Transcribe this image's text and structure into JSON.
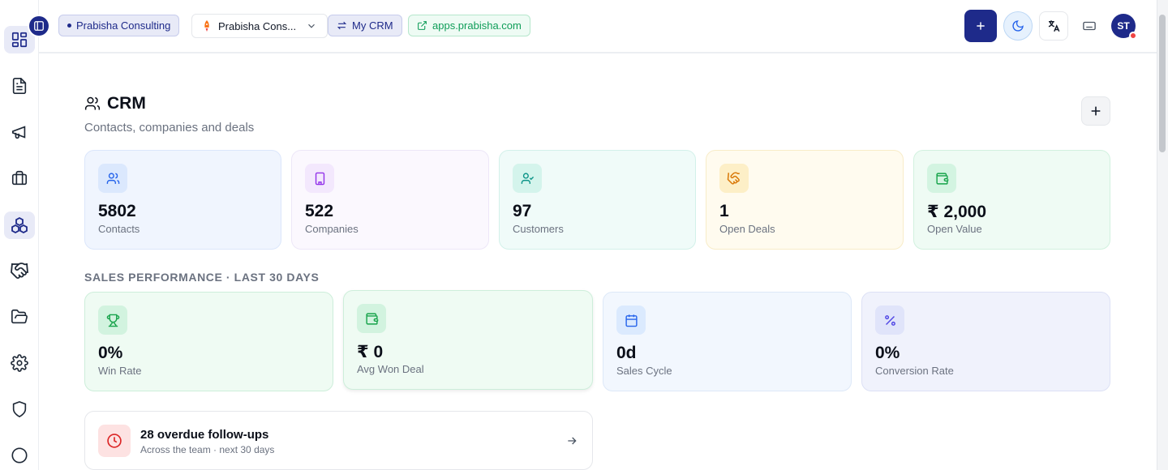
{
  "topbar": {
    "org_chip": "Prabisha Consulting",
    "workspace_switcher": "Prabisha Cons...",
    "module_chip": "My CRM",
    "url_chip": "apps.prabisha.com",
    "avatar_initials": "ST"
  },
  "sidebar": {
    "items": [
      {
        "name": "dashboard",
        "icon": "grid-icon"
      },
      {
        "name": "documents",
        "icon": "file-text-icon"
      },
      {
        "name": "campaigns",
        "icon": "megaphone-icon"
      },
      {
        "name": "projects",
        "icon": "briefcase-icon"
      },
      {
        "name": "crm",
        "icon": "boxes-icon",
        "active": true
      },
      {
        "name": "deals",
        "icon": "handshake-icon"
      },
      {
        "name": "files",
        "icon": "folder-open-icon"
      },
      {
        "name": "settings",
        "icon": "gear-icon"
      },
      {
        "name": "security",
        "icon": "shield-icon"
      },
      {
        "name": "more",
        "icon": "circle-icon"
      }
    ]
  },
  "page": {
    "title": "CRM",
    "subtitle": "Contacts, companies and deals"
  },
  "stats": [
    {
      "value": "5802",
      "label": "Contacts",
      "icon": "users-icon"
    },
    {
      "value": "522",
      "label": "Companies",
      "icon": "building-icon"
    },
    {
      "value": "97",
      "label": "Customers",
      "icon": "user-check-icon"
    },
    {
      "value": "1",
      "label": "Open Deals",
      "icon": "handshake-icon"
    },
    {
      "value": "₹ 2,000",
      "label": "Open Value",
      "icon": "wallet-icon"
    }
  ],
  "performance": {
    "section_label": "SALES PERFORMANCE · LAST 30 DAYS",
    "cards": [
      {
        "value": "0%",
        "label": "Win Rate",
        "icon": "trophy-icon"
      },
      {
        "value": "₹ 0",
        "label": "Avg Won Deal",
        "icon": "wallet-icon"
      },
      {
        "value": "0d",
        "label": "Sales Cycle",
        "icon": "calendar-icon"
      },
      {
        "value": "0%",
        "label": "Conversion Rate",
        "icon": "percent-icon"
      }
    ]
  },
  "followup": {
    "title": "28 overdue follow-ups",
    "subtitle": "Across the team · next 30 days"
  },
  "colors": {
    "primary": "#1e2a8a",
    "danger": "#ef4444",
    "green": "#0f9d58"
  }
}
